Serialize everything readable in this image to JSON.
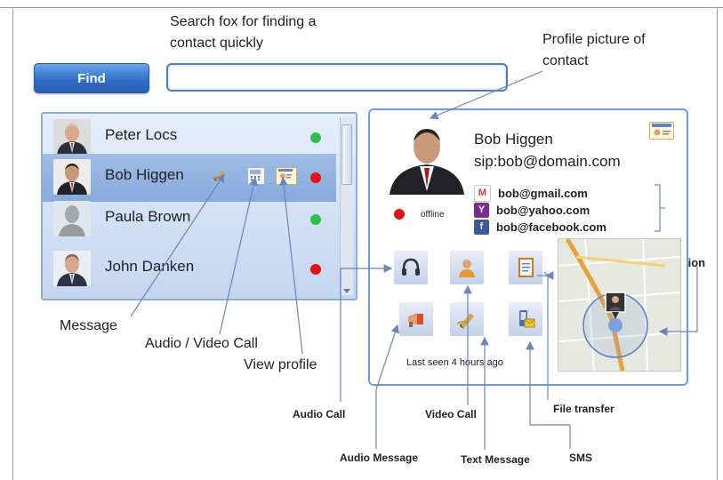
{
  "callouts": {
    "search_line1": "Search fox for finding a",
    "search_line2": "contact quickly",
    "profile_line1": "Profile picture of",
    "profile_line2": "contact",
    "geolocation": "Geolocation",
    "message": "Message",
    "audio_video_call": "Audio / Video Call",
    "view_profile": "View profile",
    "audio_call": "Audio Call",
    "video_call": "Video Call",
    "file_transfer": "File transfer",
    "audio_message": "Audio Message",
    "text_message": "Text Message",
    "sms": "SMS"
  },
  "find_button": "Find",
  "contacts": [
    {
      "name": "Peter Locs",
      "status": "online"
    },
    {
      "name": "Bob Higgen",
      "status": "busy"
    },
    {
      "name": "Paula Brown",
      "status": "online"
    },
    {
      "name": "John Danken",
      "status": "busy"
    }
  ],
  "profile": {
    "name": "Bob Higgen",
    "sip": "sip:bob@domain.com",
    "status": "offline",
    "accounts": [
      {
        "icon": "gmail-icon",
        "label": "bob@gmail.com"
      },
      {
        "icon": "yahoo-icon",
        "label": "bob@yahoo.com"
      },
      {
        "icon": "facebook-icon",
        "label": "bob@facebook.com"
      }
    ],
    "last_seen": "Last seen 4 hours ago"
  },
  "colors": {
    "online": "#2ec04a",
    "busy": "#e81010",
    "accent": "#2f6cc6"
  }
}
